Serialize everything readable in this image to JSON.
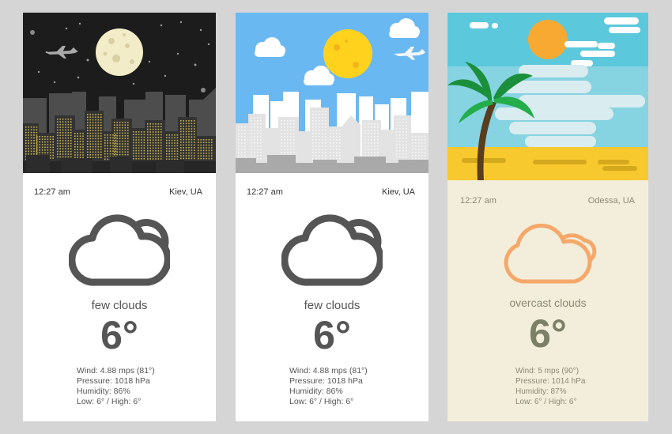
{
  "cards": [
    {
      "scene": "night-city",
      "time": "12:27 am",
      "location": "Kiev, UA",
      "condition": "few clouds",
      "temperature": "6°",
      "icon": "cloud-icon",
      "details": {
        "wind": "Wind: 4.88 mps (81°)",
        "pressure": "Pressure: 1018 hPa",
        "humidity": "Humidity: 86%",
        "low_high": "Low: 6° / High: 6°"
      }
    },
    {
      "scene": "day-city",
      "time": "12:27 am",
      "location": "Kiev, UA",
      "condition": "few clouds",
      "temperature": "6°",
      "icon": "cloud-icon",
      "details": {
        "wind": "Wind: 4.88 mps (81°)",
        "pressure": "Pressure: 1018 hPa",
        "humidity": "Humidity: 86%",
        "low_high": "Low: 6° / High: 6°"
      }
    },
    {
      "scene": "beach",
      "time": "12:27 am",
      "location": "Odessa, UA",
      "condition": "overcast clouds",
      "temperature": "6°",
      "icon": "cloud-icon",
      "details": {
        "wind": "Wind: 5 mps (90°)",
        "pressure": "Pressure: 1014 hPa",
        "humidity": "Humidity: 87%",
        "low_high": "Low: 6° / High: 6°"
      }
    }
  ],
  "colors": {
    "page_bg": "#d5d5d5",
    "card_text": "#555555",
    "beach_card_bg": "#f3eedb",
    "beach_icon": "#f5a869",
    "night_sky": "#1c1c1c",
    "day_sky": "#6ab8f2",
    "sun": "#ffd21e",
    "sea": "#5bc8dc",
    "sand": "#f8c92e"
  }
}
